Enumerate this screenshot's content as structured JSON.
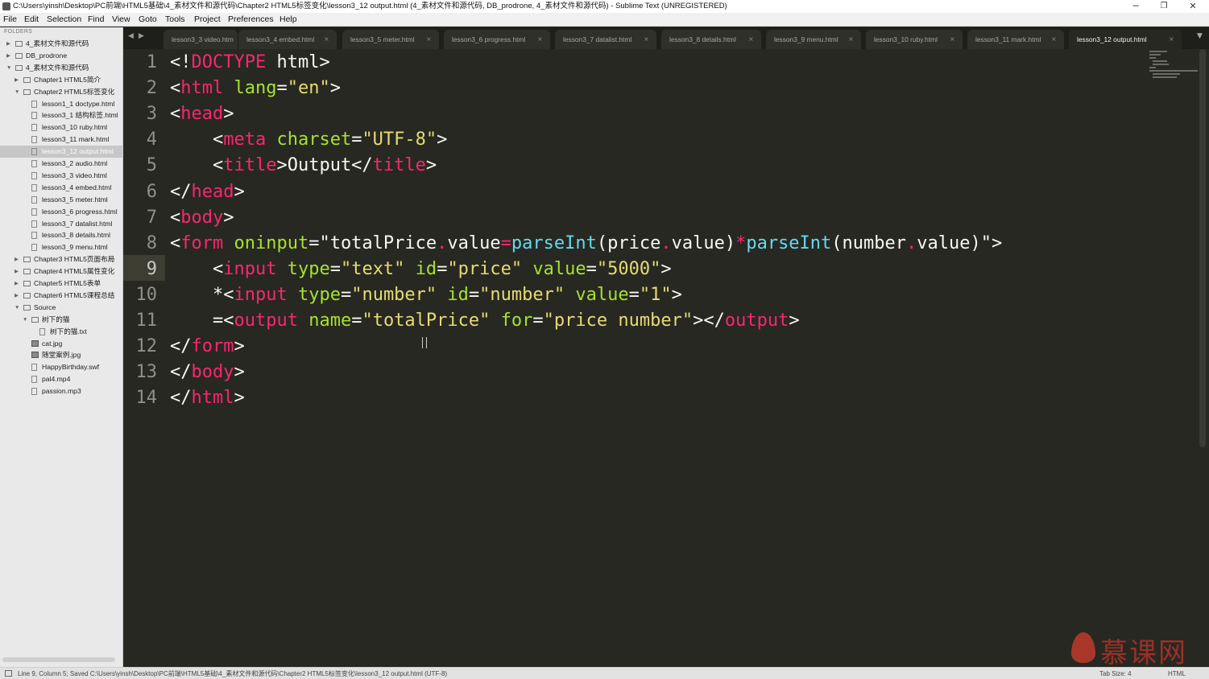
{
  "window": {
    "title": "C:\\Users\\yinsh\\Desktop\\PC前端\\HTML5基础\\4_素材文件和源代码\\Chapter2 HTML5标签变化\\lesson3_12 output.html (4_素材文件和源代码, DB_prodrone, 4_素材文件和源代码) - Sublime Text (UNREGISTERED)",
    "minimize": "─",
    "restore": "❐",
    "close": "✕"
  },
  "menu": [
    "File",
    "Edit",
    "Selection",
    "Find",
    "View",
    "Goto",
    "Tools",
    "Project",
    "Preferences",
    "Help"
  ],
  "sidebar": {
    "header": "FOLDERS",
    "items": [
      {
        "label": "4_素材文件和源代码",
        "type": "folder",
        "state": "collapsed"
      },
      {
        "label": "DB_prodrone",
        "type": "folder",
        "state": "collapsed"
      },
      {
        "label": "4_素材文件和源代码",
        "type": "folder",
        "state": "expanded"
      },
      {
        "label": "Chapter1 HTML5简介",
        "type": "folder",
        "state": "collapsed"
      },
      {
        "label": "Chapter2 HTML5标签变化",
        "type": "folder",
        "state": "expanded"
      },
      {
        "label": "lesson1_1 doctype.html",
        "type": "file"
      },
      {
        "label": "lesson3_1 结构标签.html",
        "type": "file"
      },
      {
        "label": "lesson3_10 ruby.html",
        "type": "file"
      },
      {
        "label": "lesson3_11 mark.html",
        "type": "file"
      },
      {
        "label": "lesson3_12 output.html",
        "type": "file",
        "selected": true
      },
      {
        "label": "lesson3_2 audio.html",
        "type": "file"
      },
      {
        "label": "lesson3_3 video.html",
        "type": "file"
      },
      {
        "label": "lesson3_4 embed.html",
        "type": "file"
      },
      {
        "label": "lesson3_5 meter.html",
        "type": "file"
      },
      {
        "label": "lesson3_6 progress.html",
        "type": "file"
      },
      {
        "label": "lesson3_7 datalist.html",
        "type": "file"
      },
      {
        "label": "lesson3_8 details.html",
        "type": "file"
      },
      {
        "label": "lesson3_9 menu.html",
        "type": "file"
      },
      {
        "label": "Chapter3 HTML5页面布局",
        "type": "folder",
        "state": "collapsed"
      },
      {
        "label": "Chapter4 HTML5属性变化",
        "type": "folder",
        "state": "collapsed"
      },
      {
        "label": "Chapter5 HTML5表单",
        "type": "folder",
        "state": "collapsed"
      },
      {
        "label": "Chapter6 HTML5课程总结",
        "type": "folder",
        "state": "collapsed"
      },
      {
        "label": "Source",
        "type": "folder",
        "state": "expanded"
      },
      {
        "label": "树下的猫",
        "type": "folder",
        "state": "expanded"
      },
      {
        "label": "树下的猫.txt",
        "type": "file"
      },
      {
        "label": "cat.jpg",
        "type": "image"
      },
      {
        "label": "随堂案例.jpg",
        "type": "image"
      },
      {
        "label": "HappyBirthday.swf",
        "type": "file"
      },
      {
        "label": "pal4.mp4",
        "type": "file"
      },
      {
        "label": "passion.mp3",
        "type": "file"
      }
    ]
  },
  "tabs": {
    "nav_left": "◀",
    "nav_right": "▶",
    "overflow": "▼",
    "close_glyph": "×",
    "items": [
      {
        "label": "lesson3_3 video.htm"
      },
      {
        "label": "lesson3_4 embed.html"
      },
      {
        "label": "lesson3_5 meter.html"
      },
      {
        "label": "lesson3_6 progress.html"
      },
      {
        "label": "lesson3_7 datalist.html"
      },
      {
        "label": "lesson3_8 details.html"
      },
      {
        "label": "lesson3_9 menu.html"
      },
      {
        "label": "lesson3_10 ruby.html"
      },
      {
        "label": "lesson3_11 mark.html"
      },
      {
        "label": "lesson3_12 output.html",
        "active": true
      }
    ]
  },
  "editor": {
    "current_line": 9,
    "lines": [
      [
        [
          "p",
          "<!"
        ],
        [
          "t",
          "DOCTYPE"
        ],
        [
          "p",
          " html>"
        ]
      ],
      [
        [
          "p",
          "<"
        ],
        [
          "t",
          "html"
        ],
        [
          "p",
          " "
        ],
        [
          "a",
          "lang"
        ],
        [
          "p",
          "="
        ],
        [
          "s",
          "\"en\""
        ],
        [
          "p",
          ">"
        ]
      ],
      [
        [
          "p",
          "<"
        ],
        [
          "t",
          "head"
        ],
        [
          "p",
          ">"
        ]
      ],
      [
        [
          "p",
          "    <"
        ],
        [
          "t",
          "meta"
        ],
        [
          "p",
          " "
        ],
        [
          "a",
          "charset"
        ],
        [
          "p",
          "="
        ],
        [
          "s",
          "\"UTF-8\""
        ],
        [
          "p",
          ">"
        ]
      ],
      [
        [
          "p",
          "    <"
        ],
        [
          "t",
          "title"
        ],
        [
          "p",
          ">Output</"
        ],
        [
          "t",
          "title"
        ],
        [
          "p",
          ">"
        ]
      ],
      [
        [
          "p",
          "</"
        ],
        [
          "t",
          "head"
        ],
        [
          "p",
          ">"
        ]
      ],
      [
        [
          "p",
          "<"
        ],
        [
          "t",
          "body"
        ],
        [
          "p",
          ">"
        ]
      ],
      [
        [
          "p",
          "<"
        ],
        [
          "t",
          "form"
        ],
        [
          "p",
          " "
        ],
        [
          "a",
          "oninput"
        ],
        [
          "p",
          "=\"totalPrice"
        ],
        [
          "o",
          "."
        ],
        [
          "p",
          "value"
        ],
        [
          "o",
          "="
        ],
        [
          "f",
          "parseInt"
        ],
        [
          "p",
          "(price"
        ],
        [
          "o",
          "."
        ],
        [
          "p",
          "value)"
        ],
        [
          "o",
          "*"
        ],
        [
          "f",
          "parseInt"
        ],
        [
          "p",
          "(number"
        ],
        [
          "o",
          "."
        ],
        [
          "p",
          "value)\">"
        ]
      ],
      [
        [
          "p",
          "    <"
        ],
        [
          "t",
          "input"
        ],
        [
          "p",
          " "
        ],
        [
          "a",
          "type"
        ],
        [
          "p",
          "="
        ],
        [
          "s",
          "\"text\""
        ],
        [
          "p",
          " "
        ],
        [
          "a",
          "id"
        ],
        [
          "p",
          "="
        ],
        [
          "s",
          "\"price\""
        ],
        [
          "p",
          " "
        ],
        [
          "a",
          "value"
        ],
        [
          "p",
          "="
        ],
        [
          "s",
          "\"5000\""
        ],
        [
          "p",
          ">"
        ]
      ],
      [
        [
          "p",
          "    *<"
        ],
        [
          "t",
          "input"
        ],
        [
          "p",
          " "
        ],
        [
          "a",
          "type"
        ],
        [
          "p",
          "="
        ],
        [
          "s",
          "\"number\""
        ],
        [
          "p",
          " "
        ],
        [
          "a",
          "id"
        ],
        [
          "p",
          "="
        ],
        [
          "s",
          "\"number\""
        ],
        [
          "p",
          " "
        ],
        [
          "a",
          "value"
        ],
        [
          "p",
          "="
        ],
        [
          "s",
          "\"1\""
        ],
        [
          "p",
          ">"
        ]
      ],
      [
        [
          "p",
          "    =<"
        ],
        [
          "t",
          "output"
        ],
        [
          "p",
          " "
        ],
        [
          "a",
          "name"
        ],
        [
          "p",
          "="
        ],
        [
          "s",
          "\"totalPrice\""
        ],
        [
          "p",
          " "
        ],
        [
          "a",
          "for"
        ],
        [
          "p",
          "="
        ],
        [
          "s",
          "\"price number\""
        ],
        [
          "p",
          "></"
        ],
        [
          "t",
          "output"
        ],
        [
          "p",
          ">"
        ]
      ],
      [
        [
          "p",
          "</"
        ],
        [
          "t",
          "form"
        ],
        [
          "p",
          ">"
        ]
      ],
      [
        [
          "p",
          "</"
        ],
        [
          "t",
          "body"
        ],
        [
          "p",
          ">"
        ]
      ],
      [
        [
          "p",
          "</"
        ],
        [
          "t",
          "html"
        ],
        [
          "p",
          ">"
        ]
      ]
    ]
  },
  "watermark": "慕课网",
  "status": {
    "text": "Line 9, Column 5; Saved C:\\Users\\yinsh\\Desktop\\PC前端\\HTML5基础\\4_素材文件和源代码\\Chapter2 HTML5标签变化\\lesson3_12 output.html (UTF-8)",
    "tab_size": "Tab Size: 4",
    "syntax": "HTML"
  },
  "colors": {
    "background": "#272822",
    "tag": "#f92672",
    "attribute": "#a6e22e",
    "string": "#e6db74",
    "function": "#66d9ef",
    "text": "#f8f8f2"
  }
}
